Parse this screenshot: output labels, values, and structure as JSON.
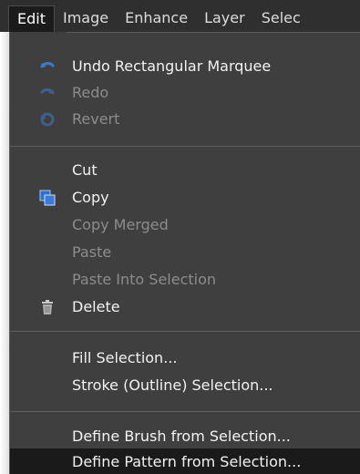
{
  "menubar": {
    "items": [
      {
        "label": "Edit"
      },
      {
        "label": "Image"
      },
      {
        "label": "Enhance"
      },
      {
        "label": "Layer"
      },
      {
        "label": "Selec"
      }
    ]
  },
  "menu": {
    "items": [
      {
        "label": "Undo Rectangular Marquee",
        "icon": "undo-icon",
        "enabled": true
      },
      {
        "label": "Redo",
        "icon": "redo-icon",
        "enabled": false
      },
      {
        "label": "Revert",
        "icon": "revert-icon",
        "enabled": false
      },
      {
        "label": "Cut",
        "icon": "",
        "enabled": true
      },
      {
        "label": "Copy",
        "icon": "copy-icon",
        "enabled": true
      },
      {
        "label": "Copy Merged",
        "icon": "",
        "enabled": false
      },
      {
        "label": "Paste",
        "icon": "",
        "enabled": false
      },
      {
        "label": "Paste Into Selection",
        "icon": "",
        "enabled": false
      },
      {
        "label": "Delete",
        "icon": "trash-icon",
        "enabled": true
      },
      {
        "label": "Fill Selection...",
        "icon": "",
        "enabled": true
      },
      {
        "label": "Stroke (Outline) Selection...",
        "icon": "",
        "enabled": true
      },
      {
        "label": "Define Brush from Selection...",
        "icon": "",
        "enabled": true
      },
      {
        "label": "Define Pattern from Selection...",
        "icon": "",
        "enabled": true,
        "highlighted": true
      }
    ]
  },
  "colors": {
    "menubar_bg": "#2f2f2f",
    "menu_bg": "#3f3f3f",
    "highlight_bg": "#1a1a1a",
    "text_enabled": "#f2f2f2",
    "text_disabled": "#8c8c8c",
    "icon_blue": "#3a7ad8"
  }
}
